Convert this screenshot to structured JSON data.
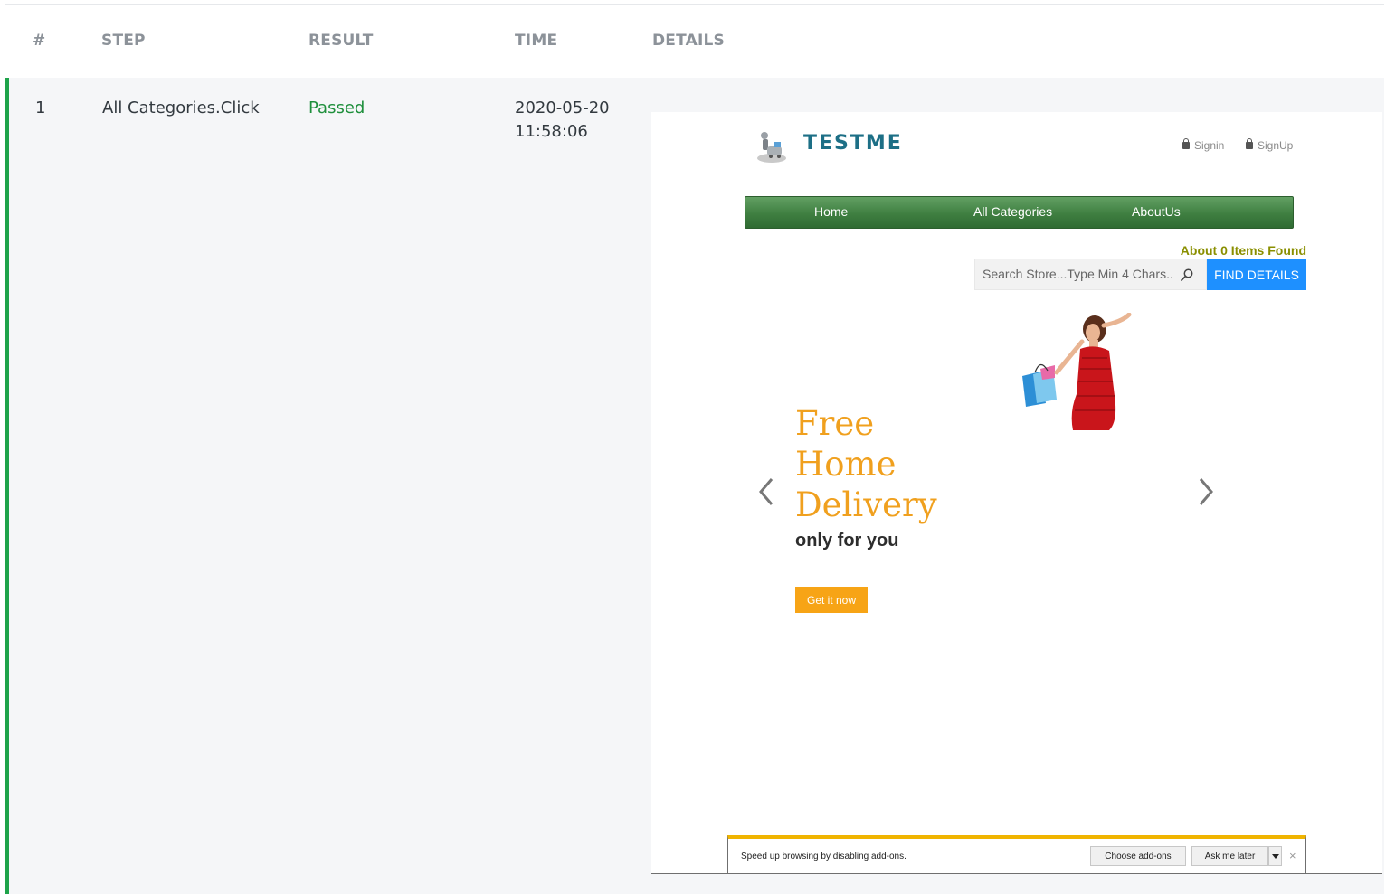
{
  "table": {
    "headers": {
      "index": "#",
      "step": "STEP",
      "result": "RESULT",
      "time": "TIME",
      "details": "DETAILS"
    },
    "rows": [
      {
        "index": "1",
        "step": "All Categories.Click",
        "result": "Passed",
        "date": "2020-05-20",
        "time": "11:58:06"
      }
    ],
    "colors": {
      "passed": "#1e8f3c",
      "row_accent": "#1ea34a"
    }
  },
  "screenshot": {
    "logo_text": "TESTME",
    "auth": {
      "signin": "Signin",
      "signup": "SignUp"
    },
    "nav": {
      "home": "Home",
      "categories": "All Categories",
      "about": "AboutUs"
    },
    "items_found": "About 0 Items Found",
    "search_placeholder": "Search Store...Type Min 4 Chars...",
    "find_button": "FIND DETAILS",
    "promo": {
      "line1": "Free",
      "line2": "Home",
      "line3": "Delivery",
      "sub": "only for you",
      "button": "Get it now"
    },
    "notification": {
      "text": "Speed up browsing by disabling add-ons.",
      "choose": "Choose add-ons",
      "ask": "Ask me later",
      "close": "×"
    }
  }
}
